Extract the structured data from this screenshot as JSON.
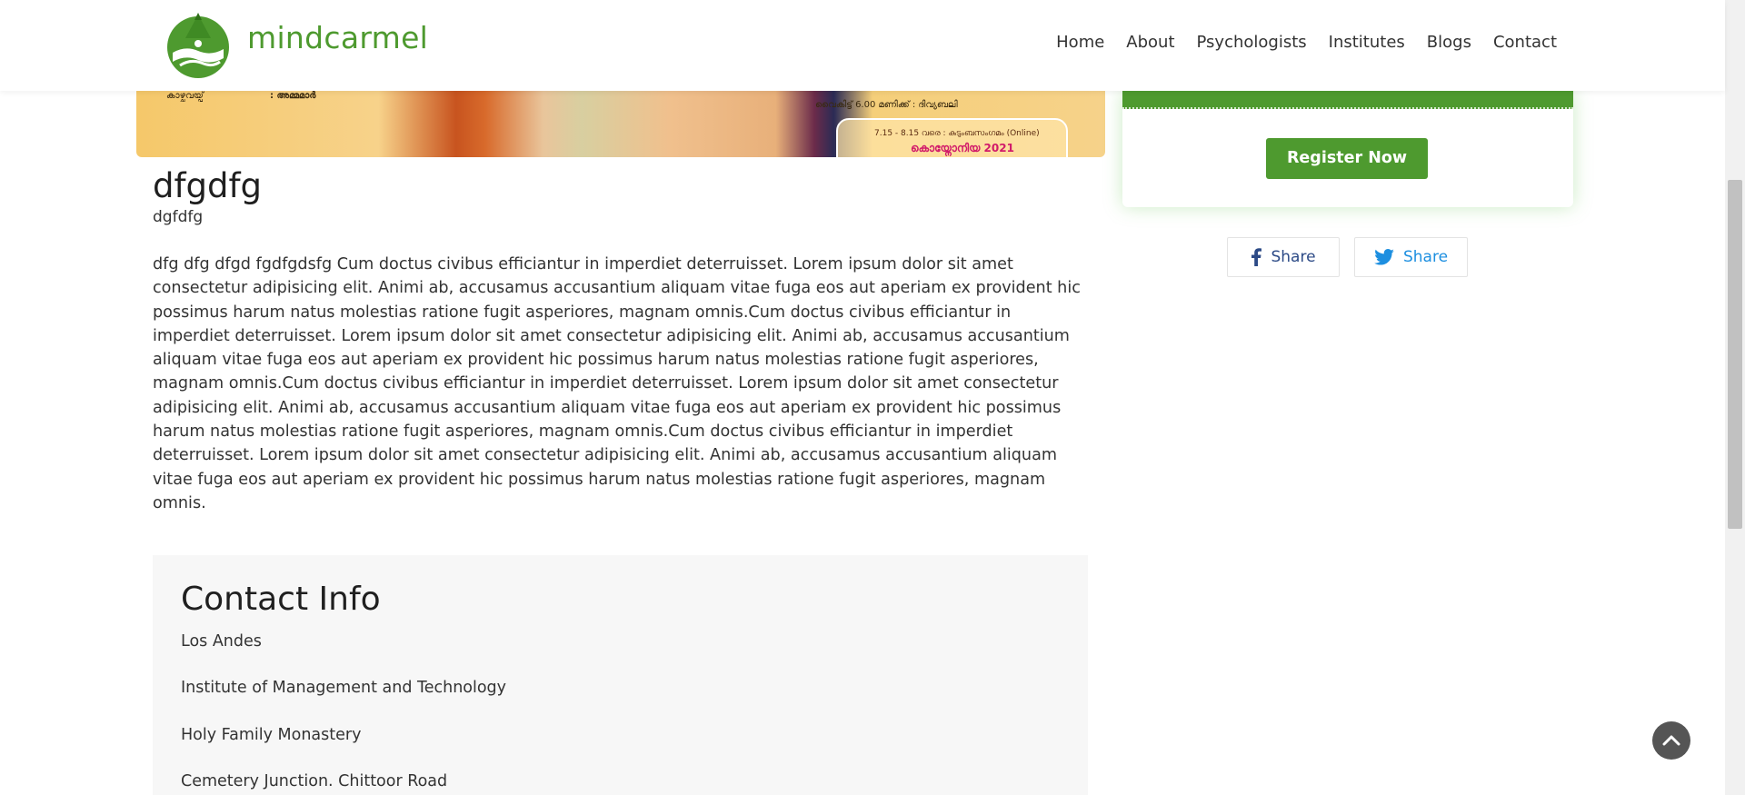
{
  "header": {
    "brand": "mindcarmel",
    "nav": [
      "Home",
      "About",
      "Psychologists",
      "Institutes",
      "Blogs",
      "Contact"
    ]
  },
  "banner": {
    "left_label": "കാഴ്ചവയ്പ്",
    "left_value": ": അമ്മമാർ",
    "right_line1": "വൈകിട്ട് 6.00 മണിക്ക് : ദിവ്യബലി",
    "badge_line1": "7.15 - 8.15 വരെ : കുടുംബസംഗമം (Online)",
    "badge_line2": "കൊയ്നോനിയ 2021"
  },
  "post": {
    "title": "dfgdfg",
    "subtitle": "dgfdfg",
    "body": "dfg dfg dfgd fgdfgdsfg Cum doctus civibus efficiantur in imperdiet deterruisset. Lorem ipsum dolor sit amet consectetur adipisicing elit. Animi ab, accusamus accusantium aliquam vitae fuga eos aut aperiam ex provident hic possimus harum natus molestias ratione fugit asperiores, magnam omnis.Cum doctus civibus efficiantur in imperdiet deterruisset. Lorem ipsum dolor sit amet consectetur adipisicing elit. Animi ab, accusamus accusantium aliquam vitae fuga eos aut aperiam ex provident hic possimus harum natus molestias ratione fugit asperiores, magnam omnis.Cum doctus civibus efficiantur in imperdiet deterruisset. Lorem ipsum dolor sit amet consectetur adipisicing elit. Animi ab, accusamus accusantium aliquam vitae fuga eos aut aperiam ex provident hic possimus harum natus molestias ratione fugit asperiores, magnam omnis.Cum doctus civibus efficiantur in imperdiet deterruisset. Lorem ipsum dolor sit amet consectetur adipisicing elit. Animi ab, accusamus accusantium aliquam vitae fuga eos aut aperiam ex provident hic possimus harum natus molestias ratione fugit asperiores, magnam omnis."
  },
  "contact": {
    "title": "Contact Info",
    "lines": [
      "Los Andes",
      "Institute of Management and Technology",
      "Holy Family Monastery",
      "Cemetery Junction. Chittoor Road"
    ]
  },
  "sidebar": {
    "register_label": "Register Now",
    "share_facebook": "Share",
    "share_twitter": "Share"
  },
  "colors": {
    "brand_green": "#4e9a2f",
    "facebook_blue": "#2c4a86",
    "twitter_blue": "#1d8fe0"
  },
  "icons": [
    "logo-icon",
    "facebook-icon",
    "twitter-icon",
    "chevron-up-icon"
  ]
}
